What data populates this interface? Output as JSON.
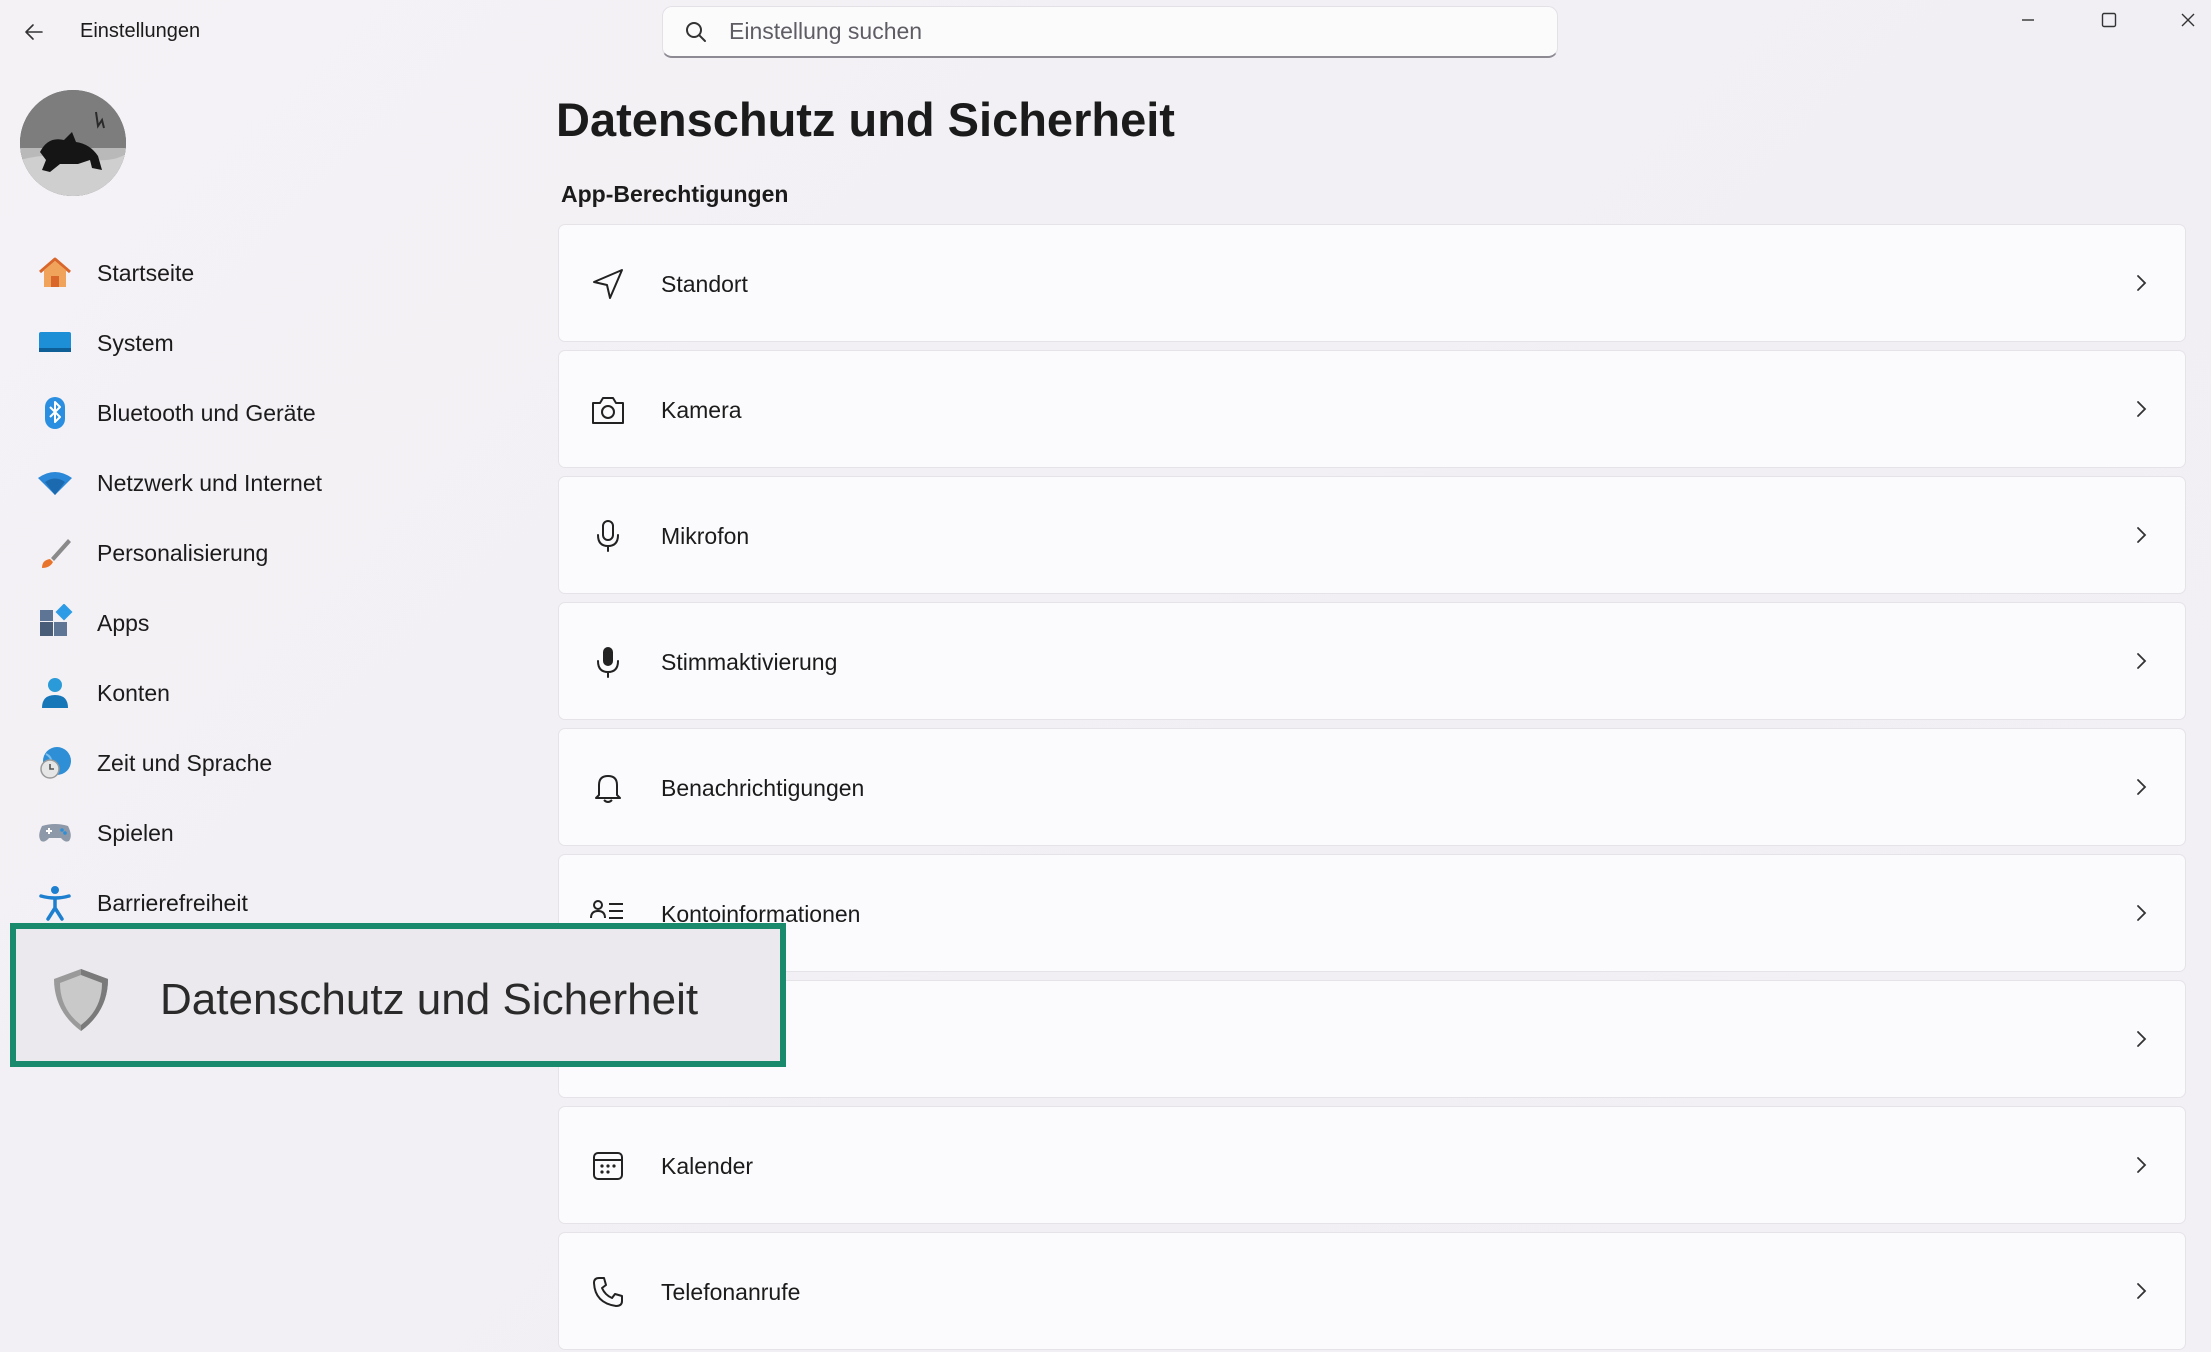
{
  "window": {
    "title": "Einstellungen",
    "back_icon": "arrow-left-icon",
    "controls": [
      "minimize-icon",
      "maximize-icon",
      "close-icon"
    ]
  },
  "search": {
    "placeholder": "Einstellung suchen",
    "value": ""
  },
  "sidebar": {
    "items": [
      {
        "label": "Startseite",
        "icon": "home-icon"
      },
      {
        "label": "System",
        "icon": "monitor-icon"
      },
      {
        "label": "Bluetooth und Geräte",
        "icon": "bluetooth-icon"
      },
      {
        "label": "Netzwerk und Internet",
        "icon": "wifi-icon"
      },
      {
        "label": "Personalisierung",
        "icon": "brush-icon"
      },
      {
        "label": "Apps",
        "icon": "apps-icon"
      },
      {
        "label": "Konten",
        "icon": "person-icon"
      },
      {
        "label": "Zeit und Sprache",
        "icon": "clock-globe-icon"
      },
      {
        "label": "Spielen",
        "icon": "gamepad-icon"
      },
      {
        "label": "Barrierefreiheit",
        "icon": "accessibility-icon"
      }
    ],
    "selected": {
      "label": "Datenschutz und Sicherheit",
      "icon": "shield-icon"
    }
  },
  "main": {
    "title": "Datenschutz und Sicherheit",
    "section": "App-Berechtigungen",
    "cards": [
      {
        "label": "Standort",
        "icon": "location-arrow-icon"
      },
      {
        "label": "Kamera",
        "icon": "camera-icon"
      },
      {
        "label": "Mikrofon",
        "icon": "microphone-icon"
      },
      {
        "label": "Stimmaktivierung",
        "icon": "voice-activation-icon"
      },
      {
        "label": "Benachrichtigungen",
        "icon": "bell-icon"
      },
      {
        "label": "Kontoinformationen",
        "icon": "account-info-icon"
      },
      {
        "label": "",
        "icon": ""
      },
      {
        "label": "Kalender",
        "icon": "calendar-icon"
      },
      {
        "label": "Telefonanrufe",
        "icon": "phone-icon"
      }
    ]
  },
  "colors": {
    "highlight_border": "#1a8a6c",
    "accent_blue": "#0067c0"
  }
}
